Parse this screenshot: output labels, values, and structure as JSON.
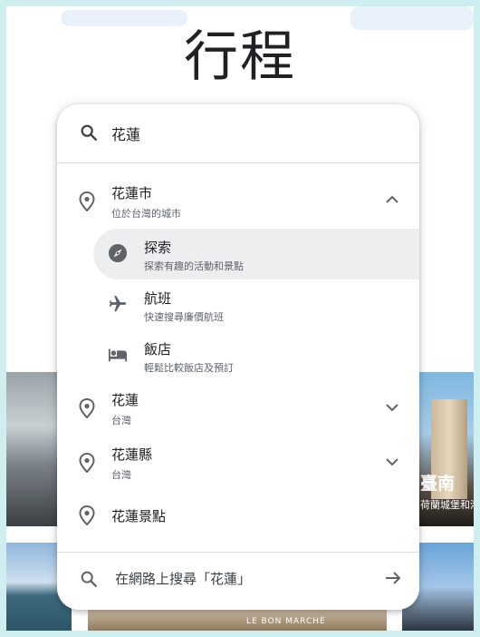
{
  "page": {
    "title": "行程"
  },
  "search": {
    "value": "花蓮",
    "placeholder": ""
  },
  "suggestions": [
    {
      "title": "花蓮市",
      "subtitle": "位於台灣的城市",
      "expanded": true,
      "children": [
        {
          "title": "探索",
          "subtitle": "探索有趣的活動和景點",
          "icon": "compass-icon",
          "selected": true
        },
        {
          "title": "航班",
          "subtitle": "快速搜尋廉價航班",
          "icon": "airplane-icon",
          "selected": false
        },
        {
          "title": "飯店",
          "subtitle": "輕鬆比較飯店及預訂",
          "icon": "bed-icon",
          "selected": false
        }
      ]
    },
    {
      "title": "花蓮",
      "subtitle": "台灣",
      "expanded": false
    },
    {
      "title": "花蓮縣",
      "subtitle": "台灣",
      "expanded": false
    },
    {
      "title": "花蓮景點",
      "subtitle": ""
    }
  ],
  "web_search": {
    "label": "在網路上搜尋「花蓮」"
  },
  "background": {
    "card_right": {
      "title": "臺南",
      "subtitle": "荷蘭城堡和港"
    },
    "card_bottom_sign": "LE BON MARCHÉ"
  },
  "colors": {
    "icon": "#5f6368",
    "text": "#202124",
    "selected_bg": "#eceef0",
    "backdrop": "#cfeef0"
  }
}
